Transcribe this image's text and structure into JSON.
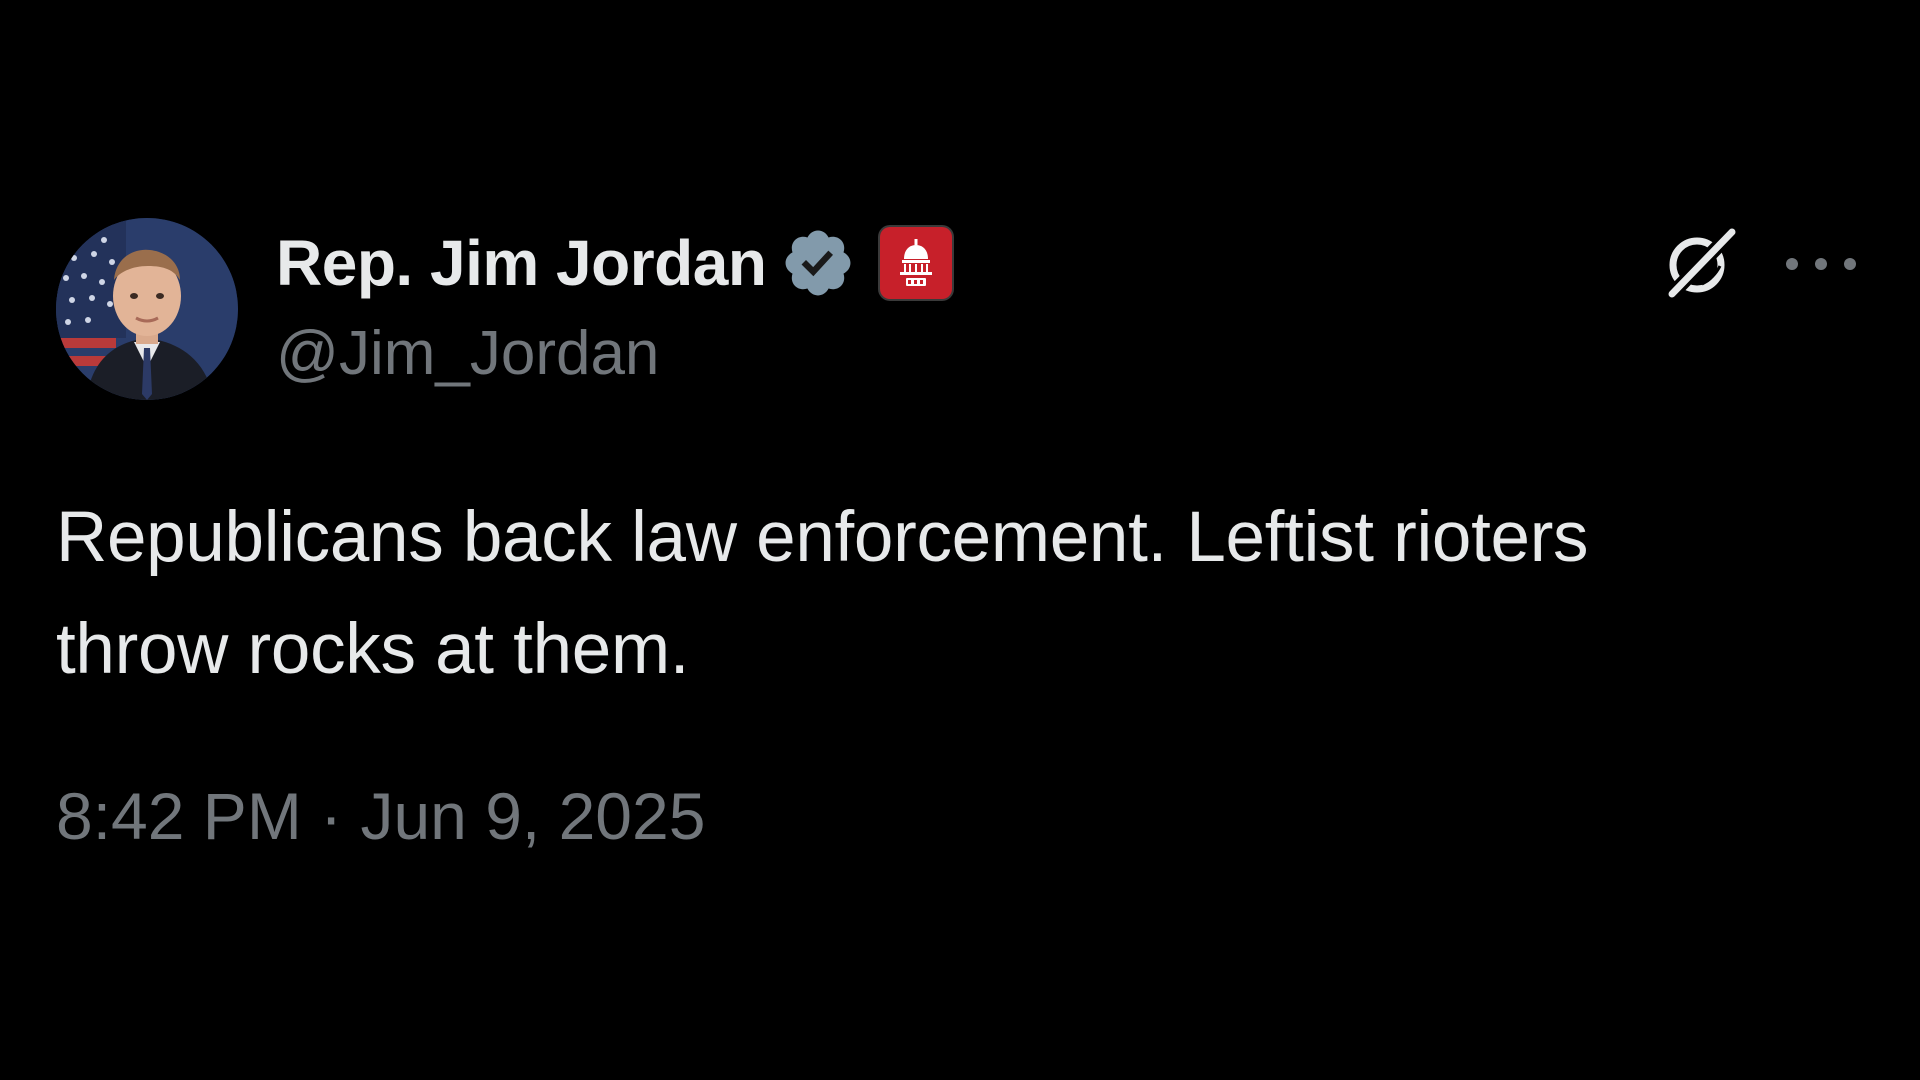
{
  "author": {
    "display_name": "Rep. Jim Jordan",
    "handle": "@Jim_Jordan",
    "verified": true,
    "verified_badge_color": "#829aab",
    "affiliate_badge_icon": "capitol-dome-icon",
    "affiliate_badge_color": "#c7202a"
  },
  "tweet": {
    "text": "Republicans back law enforcement. Leftist rioters\nthrow rocks at them.",
    "time": "8:42 PM",
    "separator": " · ",
    "date": "Jun 9, 2025"
  },
  "actions": {
    "grok_icon": "grok-icon",
    "more_icon": "more-options-icon"
  },
  "colors": {
    "background": "#000000",
    "primary_text": "#e7e9ea",
    "secondary_text": "#71767b"
  }
}
